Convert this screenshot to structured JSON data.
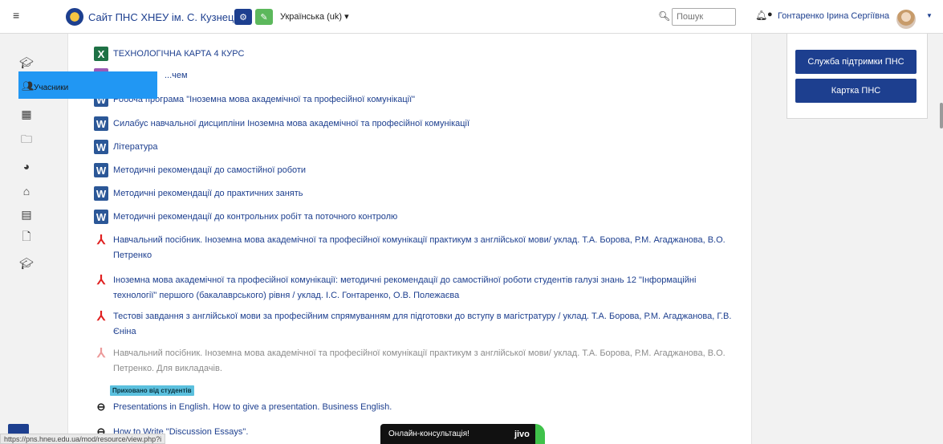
{
  "navbar": {
    "menu_icon": "hamburger-icon",
    "site_title": "Сайт ПНС ХНЕУ ім. С. Кузнеця",
    "language": "Українська (uk) ▾",
    "search_placeholder": "Пошук",
    "user_name": "Гонтаренко Ірина Сергіївна"
  },
  "sidebar": {
    "popover_label": "Учасники"
  },
  "course_items": [
    {
      "icon": "excel-icon",
      "glyph": "X",
      "text": "ТЕХНОЛОГІЧНА КАРТА 4 КУРС"
    },
    {
      "icon": "forum-icon",
      "glyph": "",
      "text": "...чем"
    },
    {
      "icon": "word-icon",
      "glyph": "W",
      "text": "Робоча програма \"Іноземна мова академічної та професійної комунікації\""
    },
    {
      "icon": "word-icon",
      "glyph": "W",
      "text": "Силабус навчальної дисципліни Іноземна мова академічної та професійної комунікації"
    },
    {
      "icon": "word-icon",
      "glyph": "W",
      "text": "Література"
    },
    {
      "icon": "word-icon",
      "glyph": "W",
      "text": "Методичні рекомендації до самостійної роботи"
    },
    {
      "icon": "word-icon",
      "glyph": "W",
      "text": "Методичні рекомендації до практичних занять"
    },
    {
      "icon": "word-icon",
      "glyph": "W",
      "text": "Методичні рекомендації до контрольних робіт та поточного контролю"
    },
    {
      "icon": "pdf-icon",
      "glyph": "⅄",
      "line1": "Навчальний посібник. Іноземна мова академічної та професійної комунікації практикум з англійської мови/ уклад. Т.А. Борова, Р.М. Агаджанова, В.О.",
      "line2": "Петренко"
    },
    {
      "icon": "pdf-icon",
      "glyph": "⅄",
      "line1": "Іноземна мова академічної та професійної комунікації: методичні рекомендації до самостійної роботи студентів галузі знань 12 \"Інформаційні",
      "line2": "технології\" першого (бакалаврського) рівня / уклад. І.С. Гонтаренко, О.В. Полежаєва"
    },
    {
      "icon": "pdf-icon",
      "glyph": "⅄",
      "line1": "Тестові завдання з англійської мови за професійним спрямуванням для підготовки до вступу в магістратуру / уклад. Т.А. Борова, Р.М. Агаджанова, Г.В.",
      "line2": "Єніна"
    },
    {
      "icon": "pdf-icon",
      "glyph": "⅄",
      "line1": "Навчальний посібник. Іноземна мова академічної та професійної комунікації практикум з англійської мови/ уклад. Т.А. Борова, Р.М. Агаджанова, В.О.",
      "line2": "Петренко. Для викладачів."
    },
    {
      "icon": "link-icon",
      "glyph": "⊖",
      "text": "Presentations in English. How to give a presentation. Business English."
    },
    {
      "icon": "link-icon",
      "glyph": "⊖",
      "text": "How to Write \"Discussion Essays\"."
    }
  ],
  "hidden_badge": "Приховано від студентів",
  "right_block": {
    "support_button": "Служба підтримки ПНС",
    "card_button": "Картка ПНС"
  },
  "status_url": "https://pns.hneu.edu.ua/mod/resource/view.php?i",
  "jivo": {
    "label": "Онлайн-консультація!",
    "logo": "jivo"
  }
}
